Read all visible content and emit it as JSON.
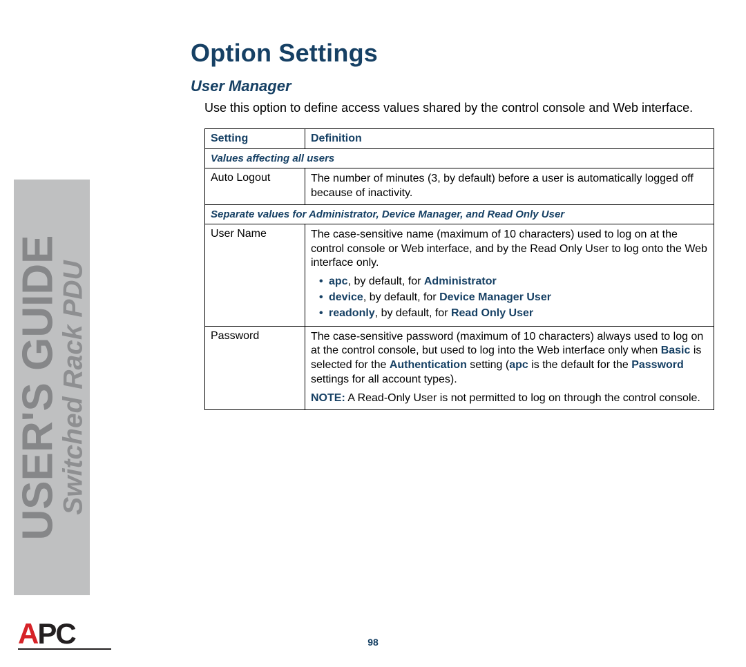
{
  "sidebar": {
    "title": "USER'S GUIDE",
    "subtitle": "Switched Rack PDU",
    "logo_red": "A",
    "logo_black": "PC"
  },
  "page": {
    "h1": "Option Settings",
    "h2": "User Manager",
    "intro": "Use this option to define access values shared by the control console and Web interface.",
    "page_number": "98"
  },
  "table": {
    "header_setting": "Setting",
    "header_definition": "Definition",
    "section1": "Values affecting all users",
    "row1_setting": "Auto Logout",
    "row1_def": "The number of minutes (3, by default) before a user is automatically logged off because of inactivity.",
    "section2": "Separate values for Administrator, Device Manager, and Read Only User",
    "row2_setting": "User Name",
    "row2_def_intro": "The case-sensitive name (maximum of 10 characters) used to log on at the control console or Web interface, and by the Read Only User to log onto the Web interface only.",
    "bullets": {
      "b1_a": "apc",
      "b1_mid": ", by default, for ",
      "b1_b": "Administrator",
      "b2_a": "device",
      "b2_mid": ", by default, for ",
      "b2_b": "Device Manager User",
      "b3_a": "readonly",
      "b3_mid": ", by default, for ",
      "b3_b": "Read Only User"
    },
    "row3_setting": "Password",
    "row3_def_p1_a": "The case-sensitive password (maximum of 10 characters) always used to log on at the control console, but used to log into the Web interface only when ",
    "row3_def_p1_basic": "Basic",
    "row3_def_p1_b": " is selected for the ",
    "row3_def_p1_auth": "Authentication",
    "row3_def_p1_c": " setting (",
    "row3_def_p1_apc": "apc",
    "row3_def_p1_d": " is the default for the ",
    "row3_def_p1_pw": "Password",
    "row3_def_p1_e": " settings for all account types).",
    "row3_note_label": "NOTE:",
    "row3_note_text": " A Read-Only User is not permitted to log on through the control console."
  }
}
